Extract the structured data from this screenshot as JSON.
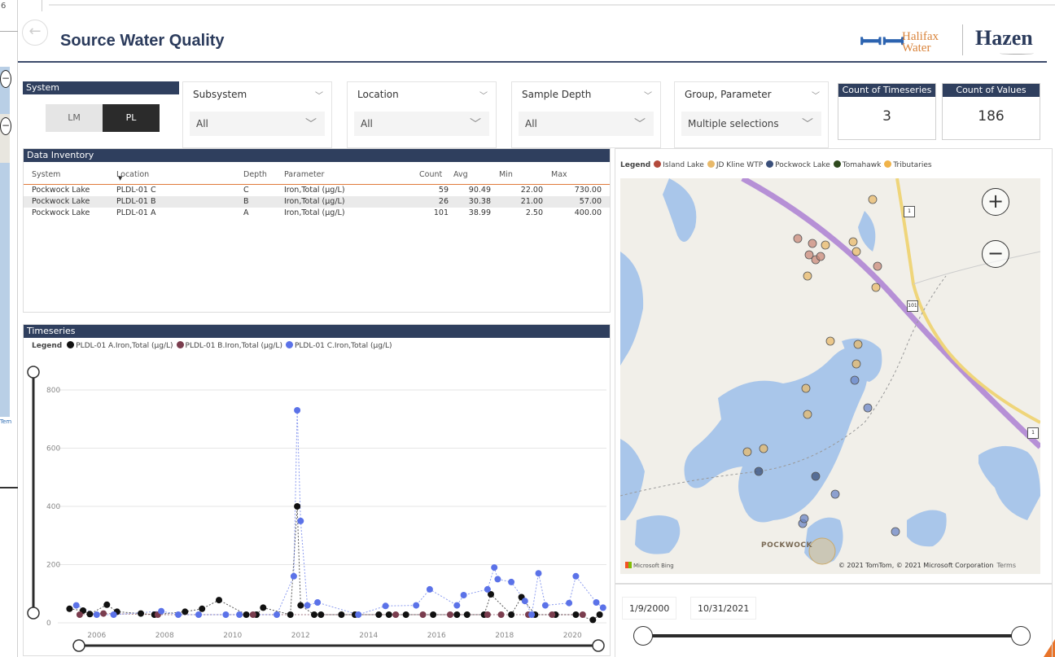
{
  "report": {
    "title": "Source Water Quality",
    "back_icon": "back-arrow-icon",
    "logos": {
      "halifax_line1": "Halifax",
      "halifax_line2": "Water",
      "hazen": "Hazen"
    }
  },
  "slicers": {
    "system": {
      "label": "System",
      "options": [
        "LM",
        "PL"
      ],
      "selected": "PL"
    },
    "subsystem": {
      "label": "Subsystem",
      "value": "All"
    },
    "location": {
      "label": "Location",
      "value": "All"
    },
    "sample_depth": {
      "label": "Sample Depth",
      "value": "All"
    },
    "group_parameter": {
      "label": "Group, Parameter",
      "value": "Multiple selections"
    }
  },
  "cards": {
    "timeseries_count": {
      "label": "Count of Timeseries",
      "value": "3"
    },
    "values_count": {
      "label": "Count of Values",
      "value": "186"
    }
  },
  "inventory": {
    "title": "Data Inventory",
    "columns": [
      "System",
      "Location",
      "Depth",
      "Parameter",
      "Count",
      "Avg",
      "Min",
      "Max"
    ],
    "rows": [
      [
        "Pockwock Lake",
        "PLDL-01 C",
        "C",
        "Iron,Total (µg/L)",
        "59",
        "90.49",
        "22.00",
        "730.00"
      ],
      [
        "Pockwock Lake",
        "PLDL-01 B",
        "B",
        "Iron,Total (µg/L)",
        "26",
        "30.38",
        "21.00",
        "57.00"
      ],
      [
        "Pockwock Lake",
        "PLDL-01 A",
        "A",
        "Iron,Total (µg/L)",
        "101",
        "38.99",
        "2.50",
        "400.00"
      ]
    ]
  },
  "timeseries": {
    "title": "Timeseries",
    "legend_label": "Legend",
    "series_labels": [
      {
        "name": "PLDL-01 A.Iron,Total (µg/L)",
        "color": "#111111"
      },
      {
        "name": "PLDL-01 B.Iron,Total (µg/L)",
        "color": "#7a3d4e"
      },
      {
        "name": "PLDL-01 C.Iron,Total (µg/L)",
        "color": "#5b72e8"
      }
    ]
  },
  "chart_data": {
    "type": "scatter",
    "xlabel": "",
    "ylabel": "",
    "xlim": [
      2005,
      2021
    ],
    "ylim": [
      0,
      800
    ],
    "x_ticks": [
      "2006",
      "2008",
      "2010",
      "2012",
      "2014",
      "2016",
      "2018",
      "2020"
    ],
    "y_ticks": [
      "0",
      "200",
      "400",
      "600",
      "800"
    ],
    "grid": true,
    "legend_position": "top-left",
    "series": [
      {
        "name": "PLDL-01 A.Iron,Total (µg/L)",
        "color": "#111111",
        "points": [
          [
            2005.2,
            48
          ],
          [
            2005.6,
            42
          ],
          [
            2005.8,
            30
          ],
          [
            2006.3,
            62
          ],
          [
            2006.6,
            38
          ],
          [
            2007.3,
            32
          ],
          [
            2007.7,
            28
          ],
          [
            2008.6,
            38
          ],
          [
            2009.1,
            48
          ],
          [
            2009.6,
            78
          ],
          [
            2010.4,
            28
          ],
          [
            2010.7,
            28
          ],
          [
            2010.9,
            52
          ],
          [
            2011.7,
            28
          ],
          [
            2011.9,
            400
          ],
          [
            2012.0,
            60
          ],
          [
            2012.4,
            28
          ],
          [
            2012.6,
            28
          ],
          [
            2013.2,
            28
          ],
          [
            2013.6,
            28
          ],
          [
            2014.3,
            28
          ],
          [
            2014.6,
            28
          ],
          [
            2015.1,
            28
          ],
          [
            2015.9,
            28
          ],
          [
            2016.6,
            28
          ],
          [
            2016.9,
            28
          ],
          [
            2017.4,
            28
          ],
          [
            2017.6,
            98
          ],
          [
            2018.2,
            28
          ],
          [
            2018.5,
            88
          ],
          [
            2018.9,
            28
          ],
          [
            2019.5,
            28
          ],
          [
            2020.1,
            28
          ],
          [
            2020.6,
            10
          ],
          [
            2020.8,
            28
          ]
        ]
      },
      {
        "name": "PLDL-01 B.Iron,Total (µg/L)",
        "color": "#7a3d4e",
        "points": [
          [
            2005.5,
            28
          ],
          [
            2006.2,
            32
          ],
          [
            2007.8,
            28
          ],
          [
            2010.6,
            28
          ],
          [
            2014.8,
            28
          ],
          [
            2015.6,
            28
          ],
          [
            2016.4,
            28
          ],
          [
            2017.5,
            28
          ],
          [
            2017.9,
            28
          ],
          [
            2018.7,
            28
          ],
          [
            2019.4,
            28
          ],
          [
            2020.3,
            28
          ]
        ]
      },
      {
        "name": "PLDL-01 C.Iron,Total (µg/L)",
        "color": "#5b72e8",
        "points": [
          [
            2005.4,
            60
          ],
          [
            2006.0,
            28
          ],
          [
            2006.5,
            28
          ],
          [
            2007.9,
            40
          ],
          [
            2008.4,
            28
          ],
          [
            2009.0,
            28
          ],
          [
            2009.8,
            28
          ],
          [
            2010.2,
            28
          ],
          [
            2011.3,
            28
          ],
          [
            2011.8,
            160
          ],
          [
            2011.9,
            730
          ],
          [
            2012.0,
            350
          ],
          [
            2012.2,
            60
          ],
          [
            2012.5,
            70
          ],
          [
            2013.7,
            28
          ],
          [
            2014.5,
            58
          ],
          [
            2015.4,
            60
          ],
          [
            2015.8,
            115
          ],
          [
            2016.6,
            60
          ],
          [
            2016.8,
            95
          ],
          [
            2017.5,
            115
          ],
          [
            2017.7,
            190
          ],
          [
            2017.8,
            150
          ],
          [
            2018.2,
            140
          ],
          [
            2018.6,
            75
          ],
          [
            2018.8,
            28
          ],
          [
            2019.0,
            170
          ],
          [
            2019.2,
            60
          ],
          [
            2019.9,
            68
          ],
          [
            2020.1,
            160
          ],
          [
            2020.7,
            70
          ],
          [
            2020.9,
            52
          ]
        ]
      }
    ]
  },
  "map": {
    "legend_label": "Legend",
    "legend_items": [
      {
        "name": "Island Lake",
        "color": "#b34a3c"
      },
      {
        "name": "JD Kline WTP",
        "color": "#e8b96a"
      },
      {
        "name": "Pockwock Lake",
        "color": "#3a4f7a"
      },
      {
        "name": "Tomahawk",
        "color": "#2f4a1e"
      },
      {
        "name": "Tributaries",
        "color": "#f0b34a"
      }
    ],
    "town_label": "POCKWOCK",
    "highway_labels": [
      "1",
      "101",
      "1"
    ],
    "copyright": "© 2021 TomTom, © 2021 Microsoft Corporation",
    "terms": "Terms",
    "provider": "Microsoft Bing",
    "zoom_in": "+",
    "zoom_out": "−"
  },
  "date_range": {
    "start": "1/9/2000",
    "end": "10/31/2021"
  },
  "background": {
    "percent_fragment": "6",
    "terms_fragment": "Tem"
  }
}
